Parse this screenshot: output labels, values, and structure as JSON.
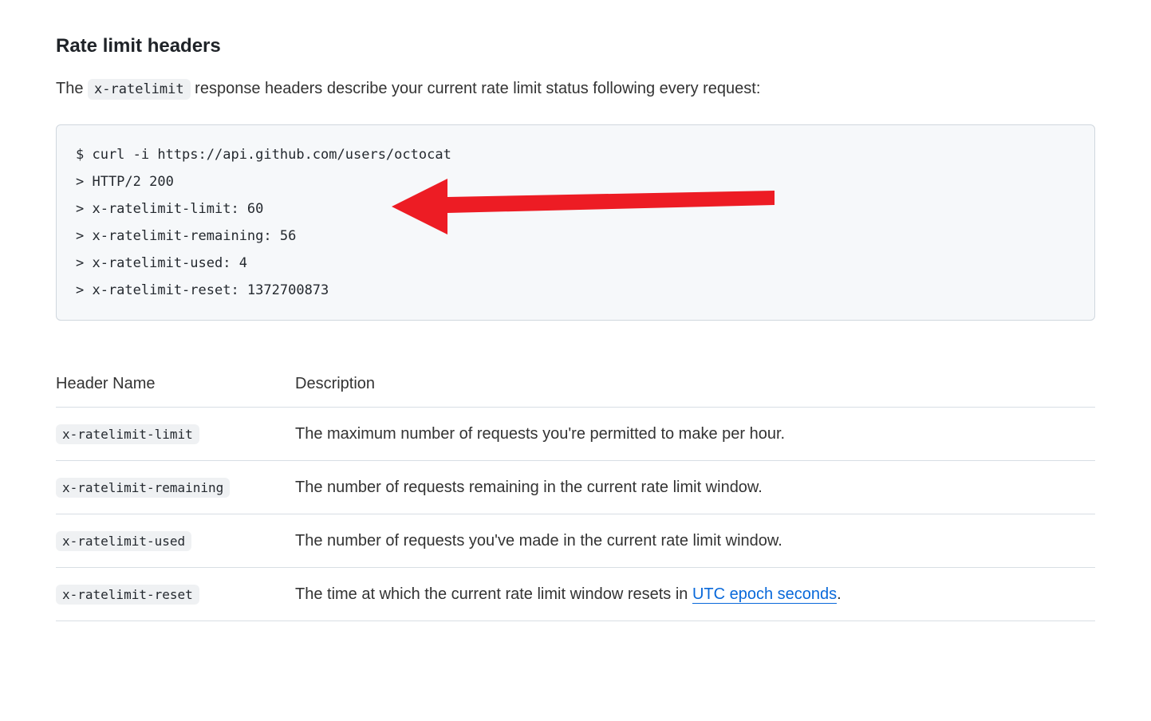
{
  "heading": "Rate limit headers",
  "intro": {
    "prefix": "The ",
    "code": "x-ratelimit",
    "suffix": " response headers describe your current rate limit status following every request:"
  },
  "code": {
    "line1": "$ curl -i https://api.github.com/users/octocat",
    "line2": "> HTTP/2 200",
    "line3": "> x-ratelimit-limit: 60",
    "line4": "> x-ratelimit-remaining: 56",
    "line5": "> x-ratelimit-used: 4",
    "line6": "> x-ratelimit-reset: 1372700873"
  },
  "table": {
    "header1": "Header Name",
    "header2": "Description",
    "rows": [
      {
        "name": "x-ratelimit-limit",
        "desc": "The maximum number of requests you're permitted to make per hour."
      },
      {
        "name": "x-ratelimit-remaining",
        "desc": "The number of requests remaining in the current rate limit window."
      },
      {
        "name": "x-ratelimit-used",
        "desc": "The number of requests you've made in the current rate limit window."
      },
      {
        "name": "x-ratelimit-reset",
        "desc_prefix": "The time at which the current rate limit window resets in ",
        "desc_link": "UTC epoch seconds",
        "desc_suffix": "."
      }
    ]
  }
}
